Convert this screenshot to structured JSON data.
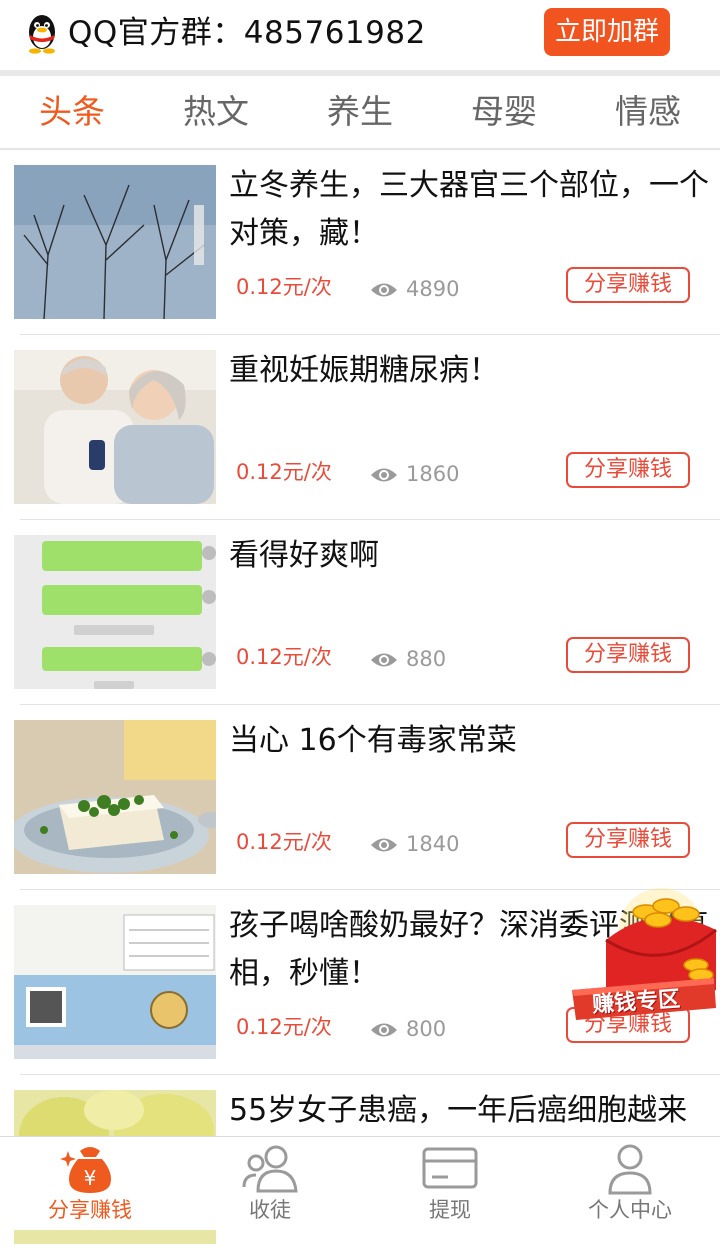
{
  "header": {
    "group_text": "QQ官方群：485761982",
    "join_button": "立即加群"
  },
  "tabs": [
    {
      "label": "头条",
      "active": true
    },
    {
      "label": "热文",
      "active": false
    },
    {
      "label": "养生",
      "active": false
    },
    {
      "label": "母婴",
      "active": false
    },
    {
      "label": "情感",
      "active": false
    }
  ],
  "articles": [
    {
      "title": "立冬养生，三大器官三个部位，一个对策，藏！",
      "price": "0.12元/次",
      "views": "4890",
      "share": "分享赚钱",
      "thumb": "winter-trees"
    },
    {
      "title": "重视妊娠期糖尿病！",
      "price": "0.12元/次",
      "views": "1860",
      "share": "分享赚钱",
      "thumb": "elderly-couple"
    },
    {
      "title": "看得好爽啊",
      "price": "0.12元/次",
      "views": "880",
      "share": "分享赚钱",
      "thumb": "chat-screenshot"
    },
    {
      "title": "当心 16个有毒家常菜",
      "price": "0.12元/次",
      "views": "1840",
      "share": "分享赚钱",
      "thumb": "tofu-dish"
    },
    {
      "title": "孩子喝啥酸奶最好？深消委评测说真相，秒懂！",
      "price": "0.12元/次",
      "views": "800",
      "share": "分享赚钱",
      "thumb": "yogurt-package"
    },
    {
      "title": "55岁女子患癌，一年后癌细胞越来",
      "price": "",
      "views": "",
      "share": "",
      "thumb": "pears"
    }
  ],
  "promo": {
    "label": "赚钱专区"
  },
  "bottom_nav": [
    {
      "label": "分享赚钱",
      "icon": "money-bag-icon",
      "active": true
    },
    {
      "label": "收徒",
      "icon": "users-icon",
      "active": false
    },
    {
      "label": "提现",
      "icon": "card-icon",
      "active": false
    },
    {
      "label": "个人中心",
      "icon": "person-icon",
      "active": false
    }
  ],
  "colors": {
    "accent": "#ef5a1e",
    "price": "#e94b3a",
    "muted": "#9a9a9a"
  }
}
